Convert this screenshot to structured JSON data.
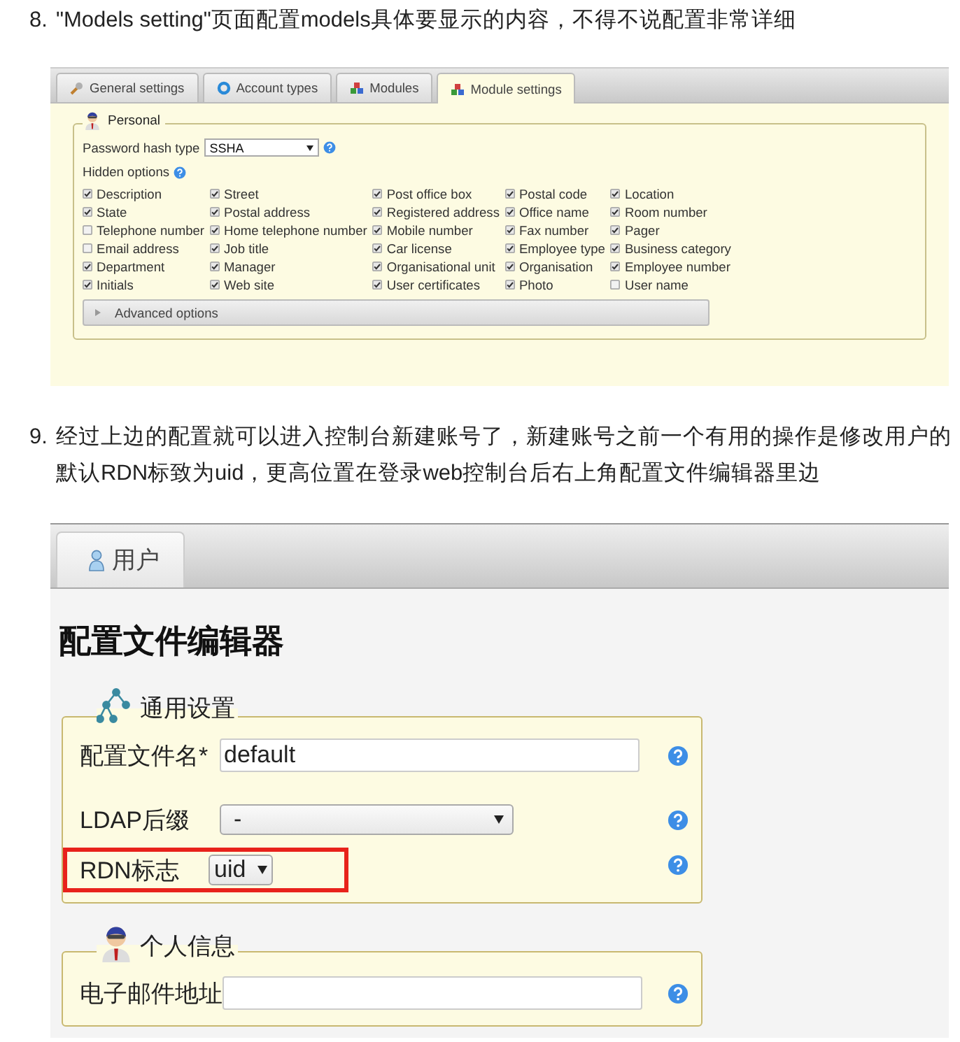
{
  "steps": [
    {
      "number": "8.",
      "text": "\"Models setting\"页面配置models具体要显示的内容，不得不说配置非常详细"
    },
    {
      "number": "9.",
      "text": "经过上边的配置就可以进入控制台新建账号了，新建账号之前一个有用的操作是修改用户的默认RDN标致为uid，更高位置在登录web控制台后右上角配置文件编辑器里边"
    }
  ],
  "module_screen": {
    "tabs": [
      {
        "label": "General settings",
        "selected": false
      },
      {
        "label": "Account types",
        "selected": false
      },
      {
        "label": "Modules",
        "selected": false
      },
      {
        "label": "Module settings",
        "selected": true
      }
    ],
    "section_title": "Personal",
    "hash_label": "Password hash type",
    "hash_value": "SSHA",
    "hidden_label": "Hidden options",
    "options": [
      {
        "label": "Description",
        "checked": true
      },
      {
        "label": "Street",
        "checked": true
      },
      {
        "label": "Post office box",
        "checked": true
      },
      {
        "label": "Postal code",
        "checked": true
      },
      {
        "label": "Location",
        "checked": true
      },
      {
        "label": "State",
        "checked": true
      },
      {
        "label": "Postal address",
        "checked": true
      },
      {
        "label": "Registered address",
        "checked": true
      },
      {
        "label": "Office name",
        "checked": true
      },
      {
        "label": "Room number",
        "checked": true
      },
      {
        "label": "Telephone number",
        "checked": false
      },
      {
        "label": "Home telephone number",
        "checked": true
      },
      {
        "label": "Mobile number",
        "checked": true
      },
      {
        "label": "Fax number",
        "checked": true
      },
      {
        "label": "Pager",
        "checked": true
      },
      {
        "label": "Email address",
        "checked": false
      },
      {
        "label": "Job title",
        "checked": true
      },
      {
        "label": "Car license",
        "checked": true
      },
      {
        "label": "Employee type",
        "checked": true
      },
      {
        "label": "Business category",
        "checked": true
      },
      {
        "label": "Department",
        "checked": true
      },
      {
        "label": "Manager",
        "checked": true
      },
      {
        "label": "Organisational unit",
        "checked": true
      },
      {
        "label": "Organisation",
        "checked": true
      },
      {
        "label": "Employee number",
        "checked": true
      },
      {
        "label": "Initials",
        "checked": true
      },
      {
        "label": "Web site",
        "checked": true
      },
      {
        "label": "User certificates",
        "checked": true
      },
      {
        "label": "Photo",
        "checked": true
      },
      {
        "label": "User name",
        "checked": false
      }
    ],
    "advanced": {
      "label": "Advanced options",
      "expanded": false
    }
  },
  "profile_screen": {
    "tabs": [
      {
        "label": "用户",
        "selected": true
      }
    ],
    "title": "配置文件编辑器",
    "groups": [
      {
        "title": "通用设置",
        "fields": [
          {
            "kind": "text",
            "label": "配置文件名*",
            "value": "default",
            "highlighted": false
          },
          {
            "kind": "select",
            "label": "LDAP后缀",
            "value": "-",
            "highlighted": false
          },
          {
            "kind": "select",
            "label": "RDN标志",
            "value": "uid",
            "highlighted": true
          }
        ]
      },
      {
        "title": "个人信息",
        "fields": [
          {
            "kind": "text",
            "label": "电子邮件地址",
            "highlighted": false
          }
        ]
      }
    ]
  }
}
